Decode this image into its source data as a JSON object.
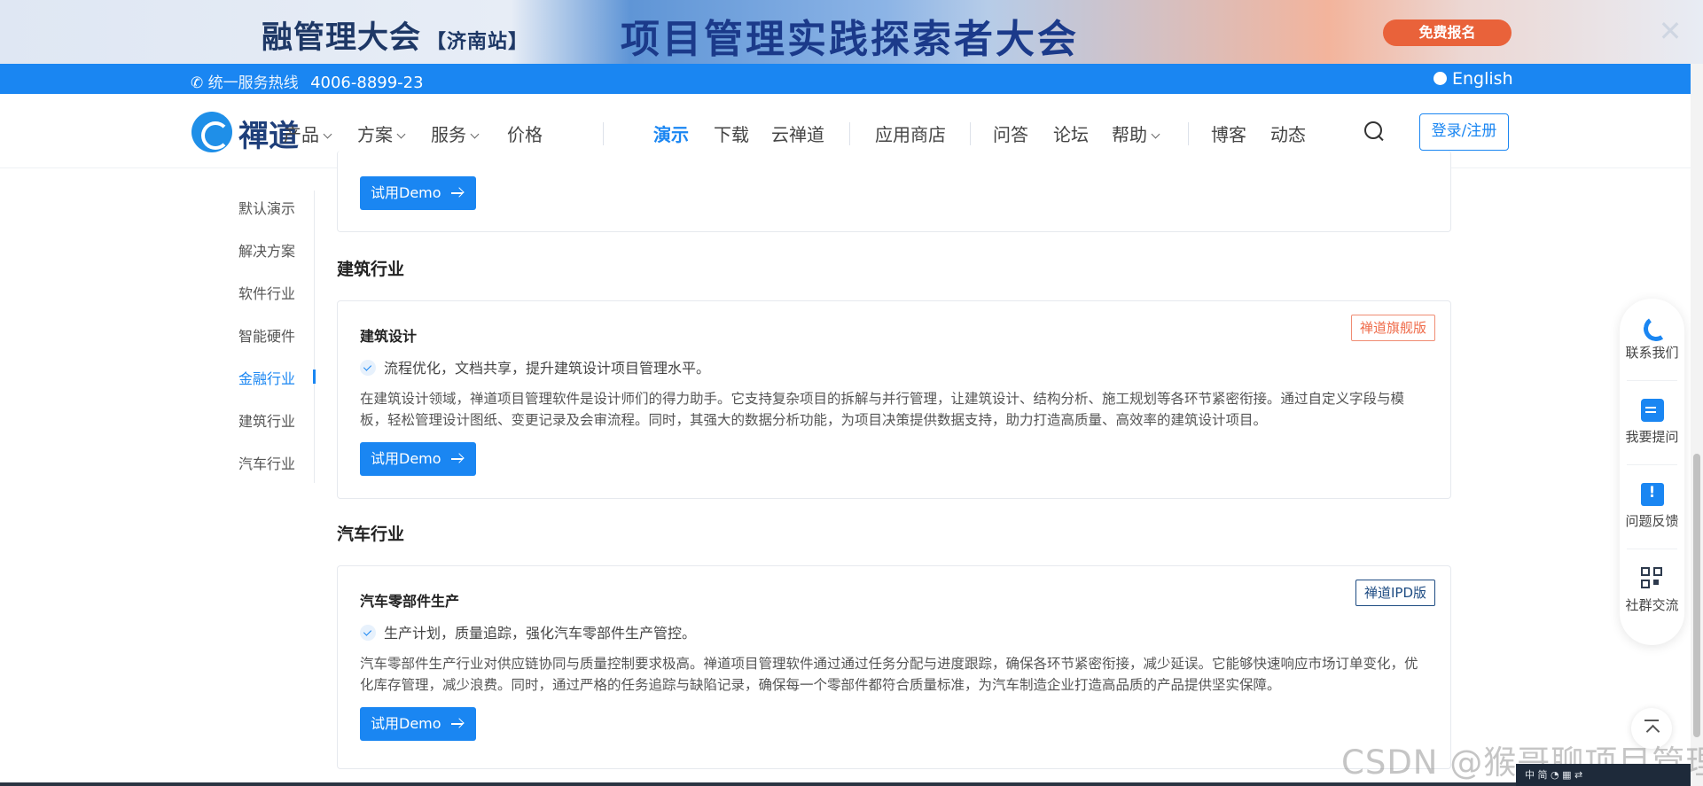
{
  "banner": {
    "left_text": "融管理大会",
    "left_sub": "【济南站】",
    "center_text": "项目管理实践探索者大会",
    "cta": "免费报名",
    "close": "✕"
  },
  "hotline": {
    "label": "统一服务热线",
    "number": "4006-8899-23",
    "language": "English"
  },
  "nav": {
    "logo_text": "禪道",
    "items": [
      "产品",
      "方案",
      "服务",
      "价格",
      "演示",
      "下载",
      "云禅道",
      "应用商店",
      "问答",
      "论坛",
      "帮助",
      "博客",
      "动态"
    ],
    "login": "登录/注册"
  },
  "side_nav": {
    "items": [
      "默认演示",
      "解决方案",
      "软件行业",
      "智能硬件",
      "金融行业",
      "建筑行业",
      "汽车行业"
    ],
    "active": "金融行业"
  },
  "sections": [
    {
      "title": "建筑行业",
      "card_title": "建筑设计",
      "badge": "禅道旗舰版",
      "highlight": "流程优化，文档共享，提升建筑设计项目管理水平。",
      "description": "在建筑设计领域，禅道项目管理软件是设计师们的得力助手。它支持复杂项目的拆解与并行管理，让建筑设计、结构分析、施工规划等各环节紧密衔接。通过自定义字段与模板，轻松管理设计图纸、变更记录及会审流程。同时，其强大的数据分析功能，为项目决策提供数据支持，助力打造高质量、高效率的建筑设计项目。",
      "button": "试用Demo"
    },
    {
      "title": "汽车行业",
      "card_title": "汽车零部件生产",
      "badge": "禅道IPD版",
      "highlight": "生产计划，质量追踪，强化汽车零部件生产管控。",
      "description": "汽车零部件生产行业对供应链协同与质量控制要求极高。禅道项目管理软件通过通过任务分配与进度跟踪，确保各环节紧密衔接，减少延误。它能够快速响应市场订单变化，优化库存管理，减少浪费。同时，通过严格的任务追踪与缺陷记录，确保每一个零部件都符合质量标准，为汽车制造企业打造高品质的产品提供坚实保障。",
      "button": "试用Demo"
    }
  ],
  "prev_card": {
    "button": "试用Demo"
  },
  "float_panel": {
    "items": [
      {
        "label": "联系我们",
        "icon": "phone-icon"
      },
      {
        "label": "我要提问",
        "icon": "edit-question-icon"
      },
      {
        "label": "问题反馈",
        "icon": "feedback-icon"
      },
      {
        "label": "社群交流",
        "icon": "qr-code-icon"
      }
    ]
  },
  "watermark": "CSDN @猴哥聊项目管理",
  "taskbar": "中  简  ◔  ▦  ⇄",
  "colors": {
    "primary": "#1a86f2",
    "flagship_badge": "#ef6b4a",
    "ipd_badge": "#1d4b82",
    "cta": "#e9623a"
  }
}
